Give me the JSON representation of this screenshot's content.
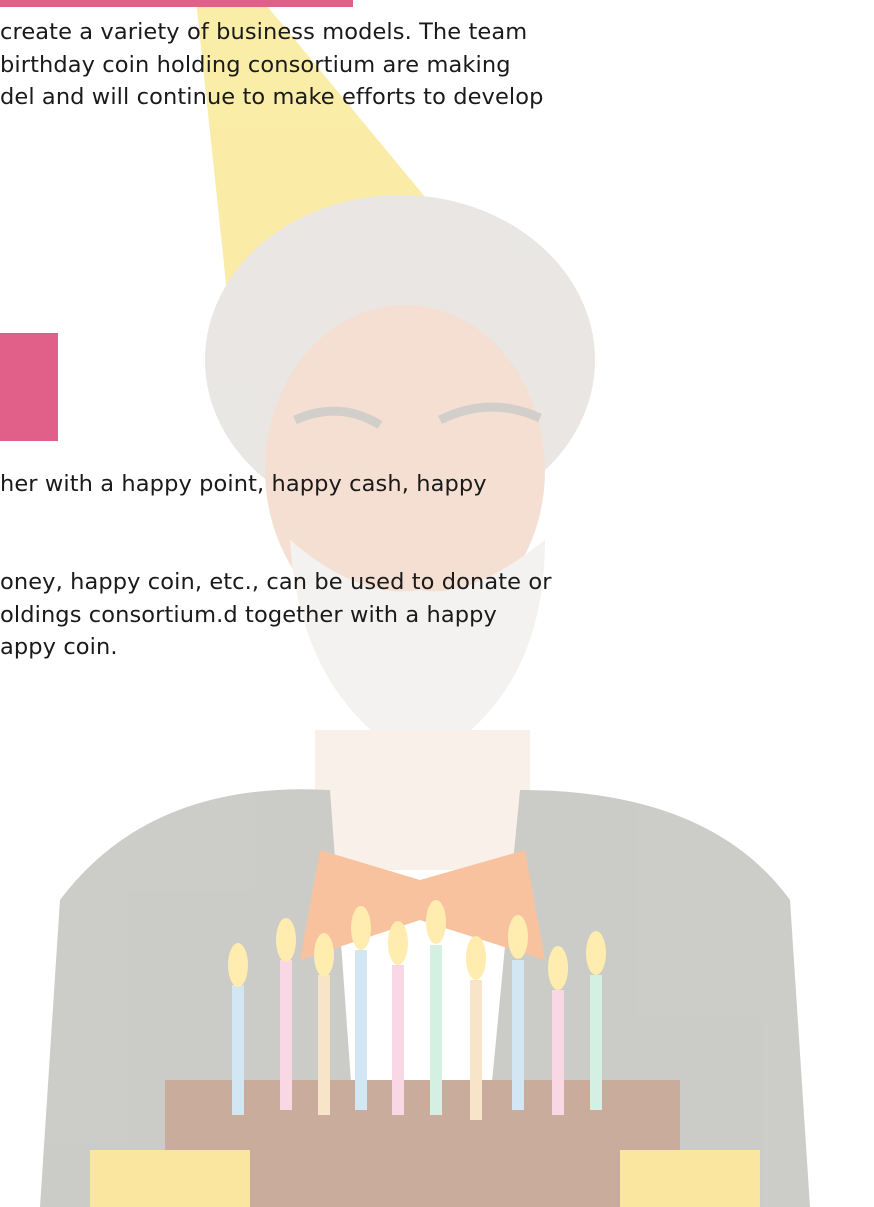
{
  "paragraphs": {
    "business_models": [
      "create a variety of business models. The team",
      "birthday coin holding consortium are making",
      "del and will continue to make efforts to develop"
    ],
    "happy_point": [
      "her with a happy point, happy cash, happy"
    ],
    "happy_money": [
      "oney, happy coin, etc., can be used to donate or",
      "oldings consortium.d together with a happy",
      "appy coin."
    ]
  },
  "image": {
    "subject": "older man with grey beard, yellow party hat and orange bow tie blowing out birthday cake candles",
    "icon": "birthday-photo"
  },
  "colors": {
    "accent": "#e0608a",
    "text": "#1a1a1a"
  }
}
